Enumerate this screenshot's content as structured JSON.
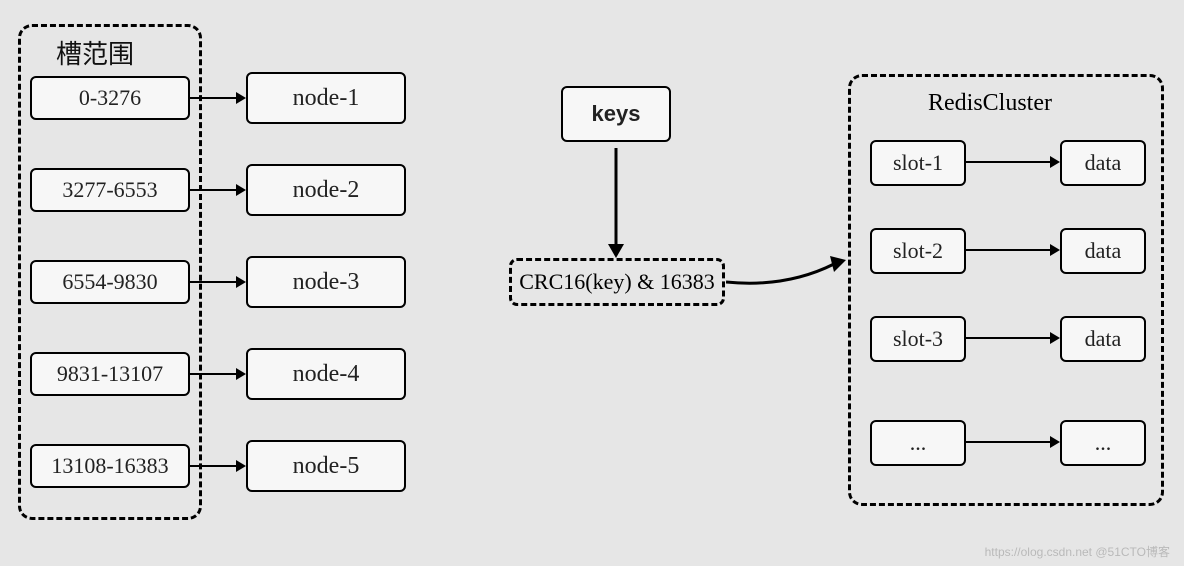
{
  "slot_title": "槽范围",
  "slot_ranges": [
    {
      "range": "0-3276",
      "node": "node-1"
    },
    {
      "range": "3277-6553",
      "node": "node-2"
    },
    {
      "range": "6554-9830",
      "node": "node-3"
    },
    {
      "range": "9831-13107",
      "node": "node-4"
    },
    {
      "range": "13108-16383",
      "node": "node-5"
    }
  ],
  "middle": {
    "keys_label": "keys",
    "hash_label": "CRC16(key) & 16383"
  },
  "cluster": {
    "title": "RedisCluster",
    "rows": [
      {
        "slot": "slot-1",
        "data": "data"
      },
      {
        "slot": "slot-2",
        "data": "data"
      },
      {
        "slot": "slot-3",
        "data": "data"
      },
      {
        "slot": "...",
        "data": "..."
      }
    ]
  },
  "watermark": "https://olog.csdn.net @51CTO博客"
}
